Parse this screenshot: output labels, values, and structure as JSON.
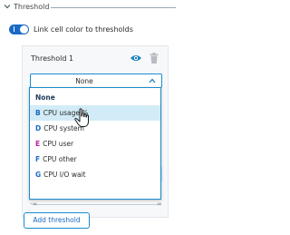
{
  "section": {
    "title": "Threshold",
    "expanded": true
  },
  "toggle": {
    "label": "Link cell color to thresholds",
    "state": "on",
    "color": "#1a6ac4"
  },
  "threshold_card": {
    "title": "Threshold 1",
    "icons": [
      "eye-icon",
      "trash-icon"
    ],
    "select": {
      "value": "None"
    }
  },
  "dropdown": {
    "options": [
      {
        "key": "",
        "label": "None",
        "header": true
      },
      {
        "key": "B",
        "label": "CPU usage %",
        "highlighted": true
      },
      {
        "key": "D",
        "label": "CPU system"
      },
      {
        "key": "E",
        "label": "CPU user"
      },
      {
        "key": "F",
        "label": "CPU other"
      },
      {
        "key": "G",
        "label": "CPU I/O wait"
      }
    ]
  },
  "range": {
    "min_label": "-∞",
    "max_label": "∞"
  },
  "add_button": {
    "label": "Add threshold"
  },
  "colors": {
    "accent": "#1a8ccf",
    "highlight": "#d2ecf7"
  }
}
